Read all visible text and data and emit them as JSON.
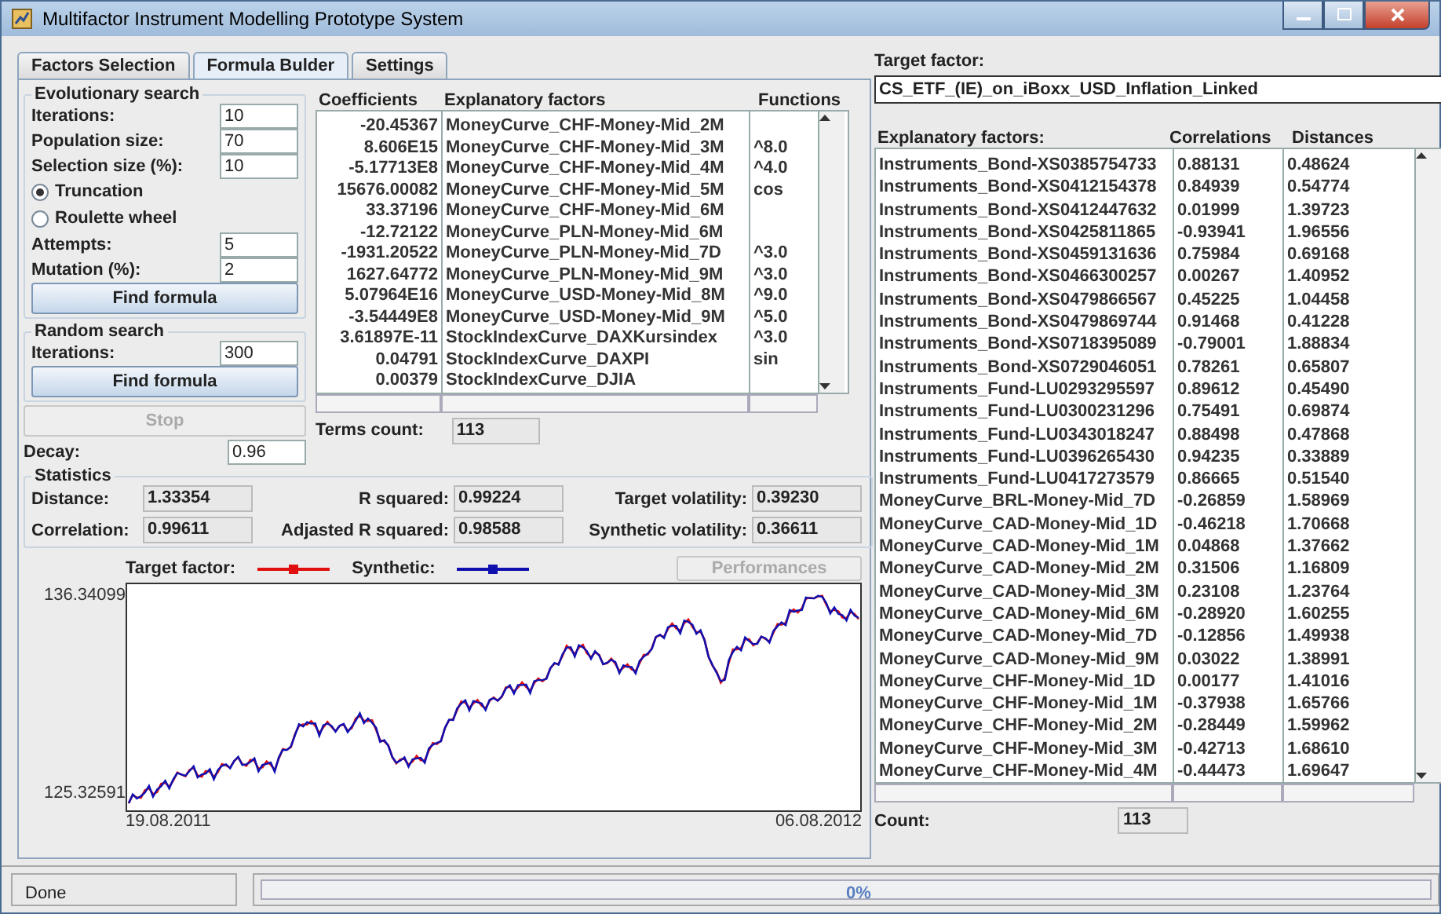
{
  "window": {
    "title": "Multifactor Instrument Modelling Prototype System"
  },
  "tabs": [
    {
      "label": "Factors Selection",
      "selected": false
    },
    {
      "label": "Formula Bulder",
      "selected": true
    },
    {
      "label": "Settings",
      "selected": false
    }
  ],
  "evolutionary_search": {
    "title": "Evolutionary search",
    "params": [
      {
        "label": "Iterations:",
        "value": "10"
      },
      {
        "label": "Population size:",
        "value": "70"
      },
      {
        "label": "Selection size (%):",
        "value": "10"
      }
    ],
    "methods": [
      {
        "label": "Truncation",
        "selected": true
      },
      {
        "label": "Roulette wheel",
        "selected": false
      }
    ],
    "params2": [
      {
        "label": "Attempts:",
        "value": "5"
      },
      {
        "label": "Mutation (%):",
        "value": "2"
      }
    ],
    "button": "Find formula"
  },
  "random_search": {
    "title": "Random search",
    "params": [
      {
        "label": "Iterations:",
        "value": "300"
      }
    ],
    "button": "Find formula"
  },
  "stop_button": {
    "label": "Stop",
    "disabled": true
  },
  "decay": {
    "label": "Decay:",
    "value": "0.96"
  },
  "coefficients_table": {
    "columns": [
      "Coefficients",
      "Explanatory factors",
      "Functions"
    ],
    "rows": [
      {
        "coefficient": "-20.45367",
        "factor": "MoneyCurve_CHF-Money-Mid_2M",
        "function": ""
      },
      {
        "coefficient": "8.606E15",
        "factor": "MoneyCurve_CHF-Money-Mid_3M",
        "function": "^8.0"
      },
      {
        "coefficient": "-5.17713E8",
        "factor": "MoneyCurve_CHF-Money-Mid_4M",
        "function": "^4.0"
      },
      {
        "coefficient": "15676.00082",
        "factor": "MoneyCurve_CHF-Money-Mid_5M",
        "function": "cos"
      },
      {
        "coefficient": "33.37196",
        "factor": "MoneyCurve_CHF-Money-Mid_6M",
        "function": ""
      },
      {
        "coefficient": "-12.72122",
        "factor": "MoneyCurve_PLN-Money-Mid_6M",
        "function": ""
      },
      {
        "coefficient": "-1931.20522",
        "factor": "MoneyCurve_PLN-Money-Mid_7D",
        "function": "^3.0"
      },
      {
        "coefficient": "1627.64772",
        "factor": "MoneyCurve_PLN-Money-Mid_9M",
        "function": "^3.0"
      },
      {
        "coefficient": "5.07964E16",
        "factor": "MoneyCurve_USD-Money-Mid_8M",
        "function": "^9.0"
      },
      {
        "coefficient": "-3.54449E8",
        "factor": "MoneyCurve_USD-Money-Mid_9M",
        "function": "^5.0"
      },
      {
        "coefficient": "3.61897E-11",
        "factor": "StockIndexCurve_DAXKursindex",
        "function": "^3.0"
      },
      {
        "coefficient": "0.04791",
        "factor": "StockIndexCurve_DAXPI",
        "function": "sin"
      },
      {
        "coefficient": "0.00379",
        "factor": "StockIndexCurve_DJIA",
        "function": ""
      }
    ]
  },
  "terms_count": {
    "label": "Terms count:",
    "value": "113"
  },
  "statistics": {
    "title": "Statistics",
    "items": [
      {
        "label": "Distance:",
        "value": "1.33354"
      },
      {
        "label": "R squared:",
        "value": "0.99224"
      },
      {
        "label": "Target volatility:",
        "value": "0.39230"
      },
      {
        "label": "Correlation:",
        "value": "0.99611"
      },
      {
        "label": "Adjasted R squared:",
        "value": "0.98588"
      },
      {
        "label": "Synthetic volatility:",
        "value": "0.36611"
      }
    ]
  },
  "chart": {
    "legend": [
      {
        "label": "Target factor:",
        "color": "#e01010"
      },
      {
        "label": "Synthetic:",
        "color": "#1010b0"
      }
    ],
    "performances_button": {
      "label": "Performances",
      "disabled": true
    },
    "y_max": "136.34099",
    "y_min": "125.32591",
    "x_start": "19.08.2011",
    "x_end": "06.08.2012"
  },
  "target_factor": {
    "label": "Target factor:",
    "value": "CS_ETF_(IE)_on_iBoxx_USD_Inflation_Linked"
  },
  "explanatory_table": {
    "title": "Explanatory factors:",
    "columns": [
      "Correlations",
      "Distances"
    ],
    "rows": [
      {
        "factor": "Instruments_Bond-XS0385754733",
        "correlation": "0.88131",
        "distance": "0.48624"
      },
      {
        "factor": "Instruments_Bond-XS0412154378",
        "correlation": "0.84939",
        "distance": "0.54774"
      },
      {
        "factor": "Instruments_Bond-XS0412447632",
        "correlation": "0.01999",
        "distance": "1.39723"
      },
      {
        "factor": "Instruments_Bond-XS0425811865",
        "correlation": "-0.93941",
        "distance": "1.96556"
      },
      {
        "factor": "Instruments_Bond-XS0459131636",
        "correlation": "0.75984",
        "distance": "0.69168"
      },
      {
        "factor": "Instruments_Bond-XS0466300257",
        "correlation": "0.00267",
        "distance": "1.40952"
      },
      {
        "factor": "Instruments_Bond-XS0479866567",
        "correlation": "0.45225",
        "distance": "1.04458"
      },
      {
        "factor": "Instruments_Bond-XS0479869744",
        "correlation": "0.91468",
        "distance": "0.41228"
      },
      {
        "factor": "Instruments_Bond-XS0718395089",
        "correlation": "-0.79001",
        "distance": "1.88834"
      },
      {
        "factor": "Instruments_Bond-XS0729046051",
        "correlation": "0.78261",
        "distance": "0.65807"
      },
      {
        "factor": "Instruments_Fund-LU0293295597",
        "correlation": "0.89612",
        "distance": "0.45490"
      },
      {
        "factor": "Instruments_Fund-LU0300231296",
        "correlation": "0.75491",
        "distance": "0.69874"
      },
      {
        "factor": "Instruments_Fund-LU0343018247",
        "correlation": "0.88498",
        "distance": "0.47868"
      },
      {
        "factor": "Instruments_Fund-LU0396265430",
        "correlation": "0.94235",
        "distance": "0.33889"
      },
      {
        "factor": "Instruments_Fund-LU0417273579",
        "correlation": "0.86665",
        "distance": "0.51540"
      },
      {
        "factor": "MoneyCurve_BRL-Money-Mid_7D",
        "correlation": "-0.26859",
        "distance": "1.58969"
      },
      {
        "factor": "MoneyCurve_CAD-Money-Mid_1D",
        "correlation": "-0.46218",
        "distance": "1.70668"
      },
      {
        "factor": "MoneyCurve_CAD-Money-Mid_1M",
        "correlation": "0.04868",
        "distance": "1.37662"
      },
      {
        "factor": "MoneyCurve_CAD-Money-Mid_2M",
        "correlation": "0.31506",
        "distance": "1.16809"
      },
      {
        "factor": "MoneyCurve_CAD-Money-Mid_3M",
        "correlation": "0.23108",
        "distance": "1.23764"
      },
      {
        "factor": "MoneyCurve_CAD-Money-Mid_6M",
        "correlation": "-0.28920",
        "distance": "1.60255"
      },
      {
        "factor": "MoneyCurve_CAD-Money-Mid_7D",
        "correlation": "-0.12856",
        "distance": "1.49938"
      },
      {
        "factor": "MoneyCurve_CAD-Money-Mid_9M",
        "correlation": "0.03022",
        "distance": "1.38991"
      },
      {
        "factor": "MoneyCurve_CHF-Money-Mid_1D",
        "correlation": "0.00177",
        "distance": "1.41016"
      },
      {
        "factor": "MoneyCurve_CHF-Money-Mid_1M",
        "correlation": "-0.37938",
        "distance": "1.65766"
      },
      {
        "factor": "MoneyCurve_CHF-Money-Mid_2M",
        "correlation": "-0.28449",
        "distance": "1.59962"
      },
      {
        "factor": "MoneyCurve_CHF-Money-Mid_3M",
        "correlation": "-0.42713",
        "distance": "1.68610"
      },
      {
        "factor": "MoneyCurve_CHF-Money-Mid_4M",
        "correlation": "-0.44473",
        "distance": "1.69647"
      }
    ]
  },
  "count": {
    "label": "Count:",
    "value": "113"
  },
  "status_bar": {
    "text": "Done",
    "progress_text": "0%",
    "level": 0
  }
}
